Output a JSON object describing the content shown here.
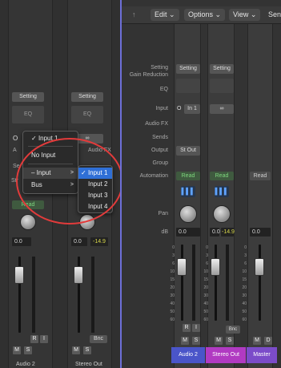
{
  "toolbar": {
    "edit": "Edit",
    "options": "Options",
    "view": "View",
    "cut": "Sen"
  },
  "left": {
    "setting_a": "Setting",
    "setting_b": "Setting",
    "eq_a": "EQ",
    "eq_b": "EQ",
    "input_char": "O",
    "link_icon": "∞",
    "read_a": "Read",
    "pan_val_a": "0.0",
    "pan_val_b": "0.0",
    "db_b": "-14.9",
    "ri_r": "R",
    "ri_i": "I",
    "bnc": "Bnc",
    "m": "M",
    "s": "S",
    "name_a": "Audio 2",
    "name_b": "Stereo Out",
    "hidden_a": "A",
    "hidden_b": "Audio FX",
    "hidden_c": "Se",
    "hidden_d": "Str"
  },
  "menu": {
    "items": [
      {
        "label": "Input 1",
        "checked": true
      },
      {
        "label": "No Input"
      },
      {
        "label": "Input",
        "submenu": true,
        "selected": true
      },
      {
        "label": "Bus",
        "submenu": true
      }
    ],
    "sub": [
      {
        "label": "Input 1",
        "checked": true,
        "selected": true
      },
      {
        "label": "Input 2"
      },
      {
        "label": "Input 3"
      },
      {
        "label": "Input 4"
      }
    ]
  },
  "right": {
    "labels": {
      "setting": "Setting",
      "gain_reduction": "Gain Reduction",
      "eq": "EQ",
      "input": "Input",
      "audio_fx": "Audio FX",
      "sends": "Sends",
      "output": "Output",
      "group": "Group",
      "automation": "Automation",
      "pan": "Pan",
      "db": "dB"
    },
    "strip1": {
      "setting": "Setting",
      "input_circle": "O",
      "input": "In 1",
      "output": "St Out",
      "automation": "Read",
      "pan": "0.0",
      "db": "0.0",
      "name": "Audio 2"
    },
    "strip2": {
      "setting": "Setting",
      "link": "∞",
      "automation": "Read",
      "pan": "0.0",
      "db": "-14.9",
      "name": "Stereo Out",
      "bnc": "Bnc"
    },
    "strip3": {
      "automation": "Read",
      "db": "0.0",
      "name": "Master"
    },
    "ri_r": "R",
    "ri_i": "I",
    "m": "M",
    "s": "S",
    "d": "D",
    "scale": [
      "0",
      "3",
      "6",
      "10",
      "15",
      "20",
      "30",
      "40",
      "50",
      "60"
    ]
  },
  "colors": {
    "highlight_oval": "#e23b3b",
    "accent_border": "#6d6fd8",
    "audio2": "#4a55c9",
    "stereo_out": "#b13ac2",
    "master": "#7b4cc9",
    "menu_selected": "#2f6fd6"
  }
}
